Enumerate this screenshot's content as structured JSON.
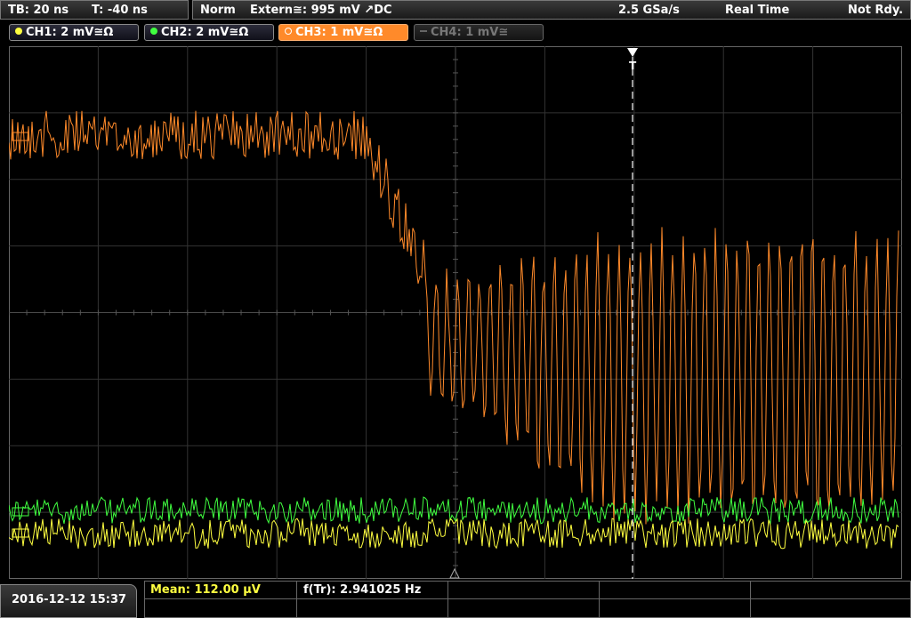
{
  "header": {
    "timebase": "TB: 20 ns",
    "trigger_time": "T: -40 ns",
    "mode": "Norm",
    "trigger_source": "Extern≅: 995 mV ↗DC",
    "sample_rate": "2.5 GSa/s",
    "acq_mode": "Real Time",
    "status": "Not Rdy."
  },
  "channels": [
    {
      "label": "CH1: 2 mV≅Ω",
      "color": "#ffff40",
      "state": "on"
    },
    {
      "label": "CH2: 2 mV≅Ω",
      "color": "#40ff40",
      "state": "on"
    },
    {
      "label": "CH3: 1 mV≅Ω",
      "color": "#ff8a2a",
      "state": "selected"
    },
    {
      "label": "CH4: 1 mV≅",
      "color": "#777777",
      "state": "off"
    }
  ],
  "footer": {
    "datetime": "2016-12-12 15:37",
    "mean": "Mean: 112.00 µV",
    "freq": "f(Tr): 2.941025 Hz"
  },
  "colors": {
    "ch1": "#ffff40",
    "ch2": "#40ff40",
    "ch3": "#ff8a2a",
    "grid": "#3a3a3a"
  }
}
